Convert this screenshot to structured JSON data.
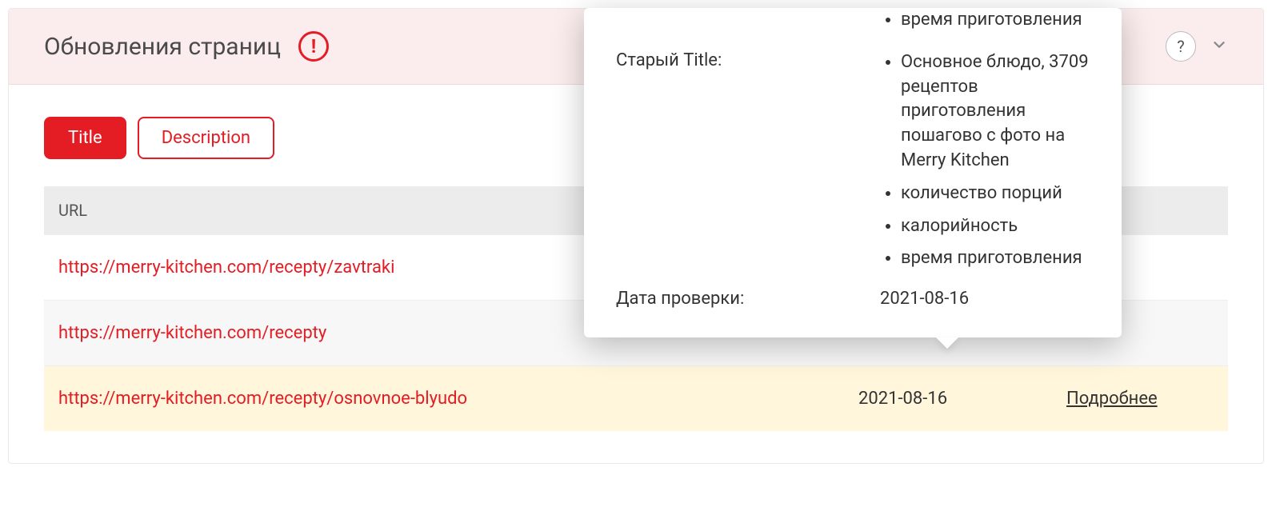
{
  "panel": {
    "title": "Обновления страниц",
    "help_label": "?"
  },
  "tabs": {
    "title": "Title",
    "description": "Description"
  },
  "table": {
    "headers": {
      "url": "URL"
    },
    "rows": [
      {
        "url": "https://merry-kitchen.com/recepty/zavtraki",
        "date": "",
        "details": ""
      },
      {
        "url": "https://merry-kitchen.com/recepty",
        "date": "",
        "details": ""
      },
      {
        "url": "https://merry-kitchen.com/recepty/osnovnoe-blyudo",
        "date": "2021-08-16",
        "details": "Подробнее"
      }
    ]
  },
  "tooltip": {
    "top_items": [
      "время приготовления"
    ],
    "old_title_label": "Старый Title:",
    "old_title_items": [
      "Основное блюдо, 3709 рецептов приготовления пошагово с фото на Merry Kitchen",
      "количество порций",
      "калорийность",
      "время приготовления"
    ],
    "check_date_label": "Дата проверки:",
    "check_date_value": "2021-08-16"
  }
}
